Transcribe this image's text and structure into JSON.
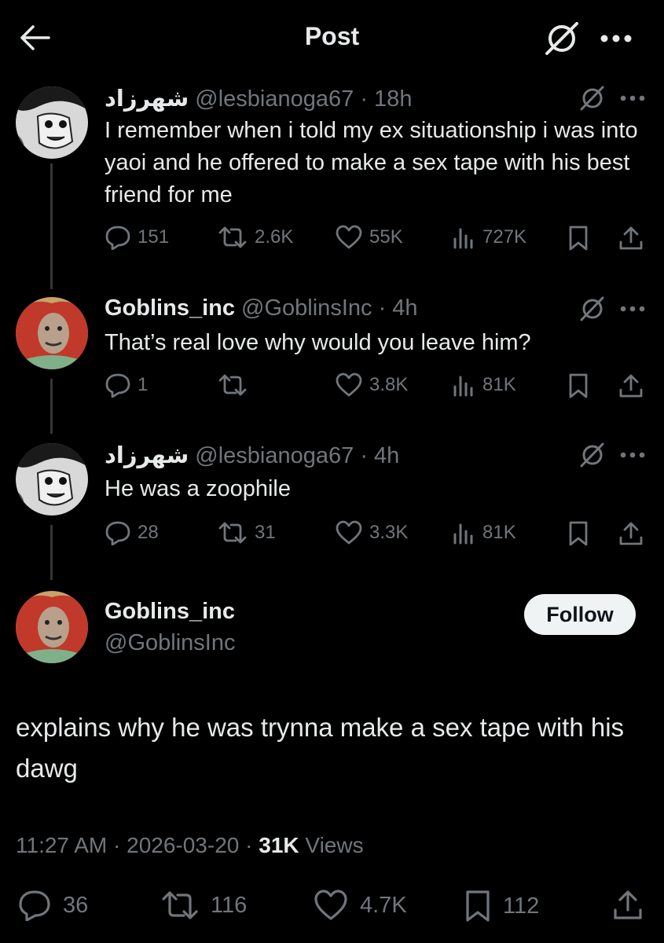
{
  "header": {
    "title": "Post",
    "back_icon": "arrow-left-icon",
    "grok_icon": "grok-icon",
    "more_icon": "more-horizontal-icon"
  },
  "colors": {
    "background": "#000000",
    "text": "#e7e9ea",
    "muted": "#71767b",
    "thread_line": "#333639"
  },
  "thread": [
    {
      "name": "شهرزاد",
      "handle": "@lesbianoga67",
      "time": "· 18h",
      "text": "I remember when i told my ex situationship i was into yaoi and he offered to make a sex tape with his best friend for me",
      "replies": "151",
      "reposts": "2.6K",
      "likes": "55K",
      "views": "727K"
    },
    {
      "name": "Goblins_inc",
      "handle": "@GoblinsInc",
      "time": "· 4h",
      "text": "That’s real love why would you leave him?",
      "replies": "1",
      "reposts": "",
      "likes": "3.8K",
      "views": "81K"
    },
    {
      "name": "شهرزاد",
      "handle": "@lesbianoga67",
      "time": "· 4h",
      "text": "He was a zoophile",
      "replies": "28",
      "reposts": "31",
      "likes": "3.3K",
      "views": "81K"
    }
  ],
  "main_post": {
    "name": "Goblins_inc",
    "handle": "@GoblinsInc",
    "follow_label": "Follow",
    "text": "explains why he was trynna make a sex tape with his dawg",
    "time": "11:27 AM",
    "date": "2026-03-20",
    "views_count": "31K",
    "views_label": "Views",
    "replies": "36",
    "reposts": "116",
    "likes": "4.7K",
    "bookmarks": "112"
  }
}
